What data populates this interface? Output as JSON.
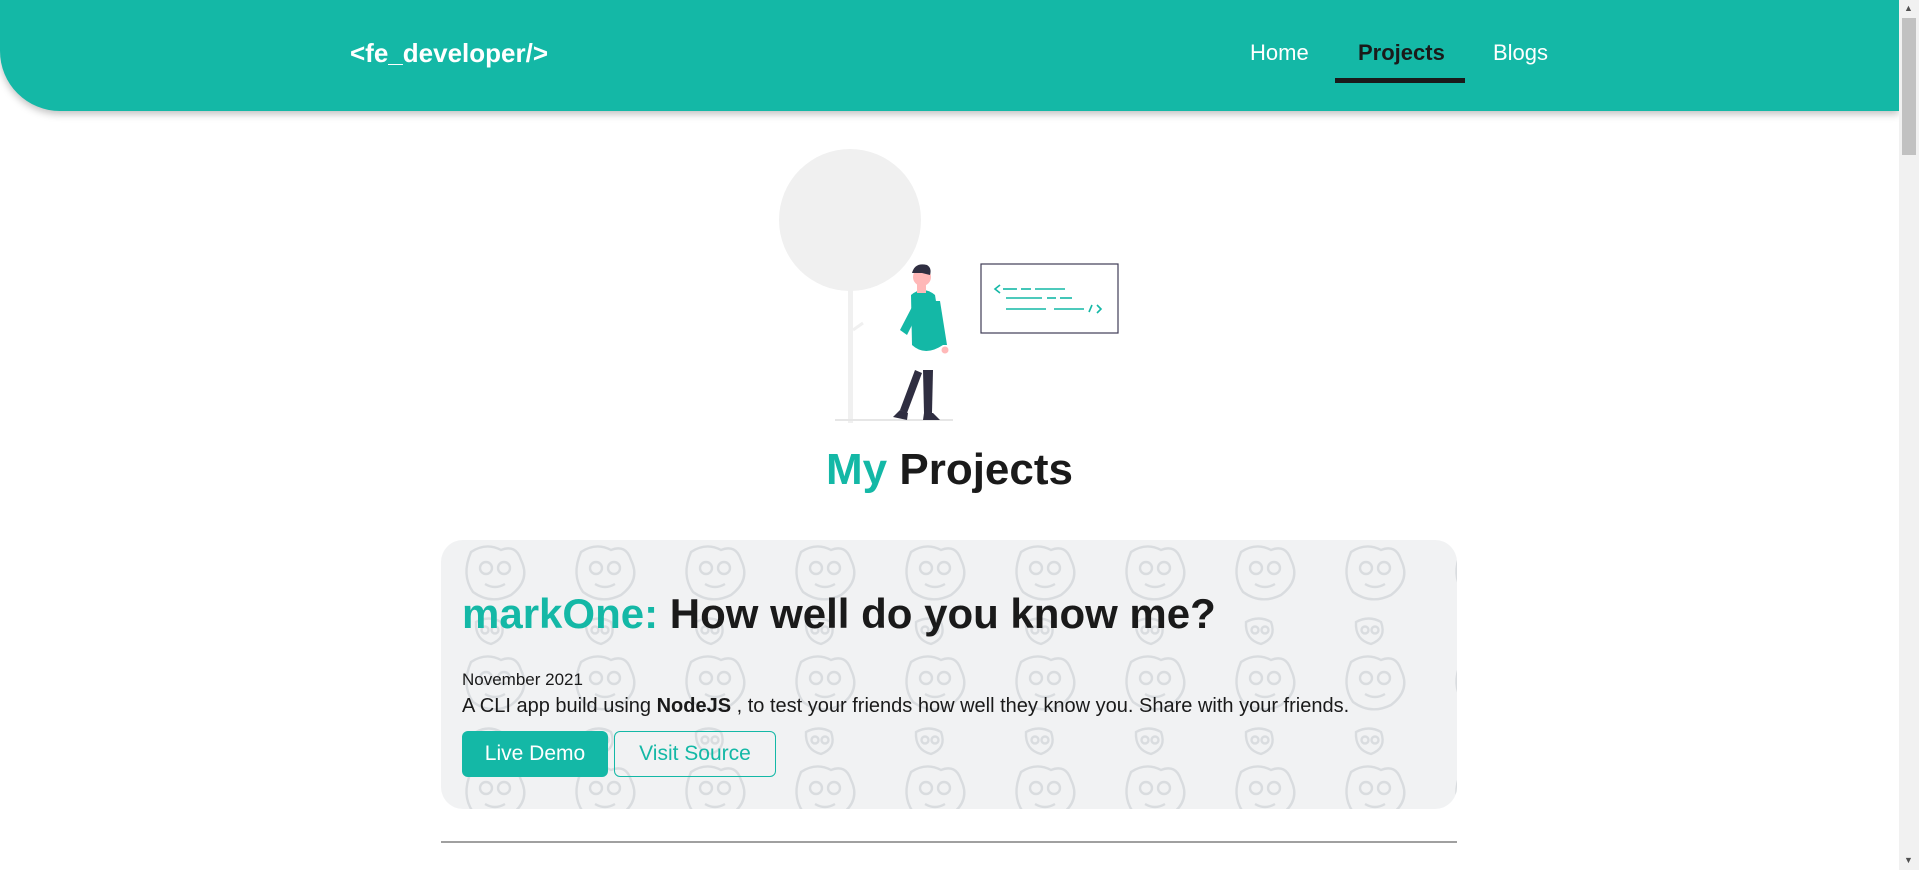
{
  "header": {
    "logo": "<fe_developer/>",
    "nav": [
      {
        "label": "Home",
        "active": false
      },
      {
        "label": "Projects",
        "active": true
      },
      {
        "label": "Blogs",
        "active": false
      }
    ]
  },
  "main": {
    "title_accent": "My",
    "title_rest": "Projects"
  },
  "projects": [
    {
      "name": "markOne:",
      "tagline": "How well do you know me?",
      "date": "November 2021",
      "desc_before": "A CLI app build using",
      "desc_tech": "NodeJS",
      "desc_after": ", to test your friends how well they know you. Share with your friends.",
      "live_demo_label": "Live Demo",
      "visit_source_label": "Visit Source"
    }
  ],
  "colors": {
    "accent": "#14b8a6",
    "text": "#1a1a1a",
    "card_bg": "#f1f2f3"
  },
  "icons": {
    "scroll_up": "scroll-up-arrow-icon",
    "scroll_down": "scroll-down-arrow-icon"
  }
}
